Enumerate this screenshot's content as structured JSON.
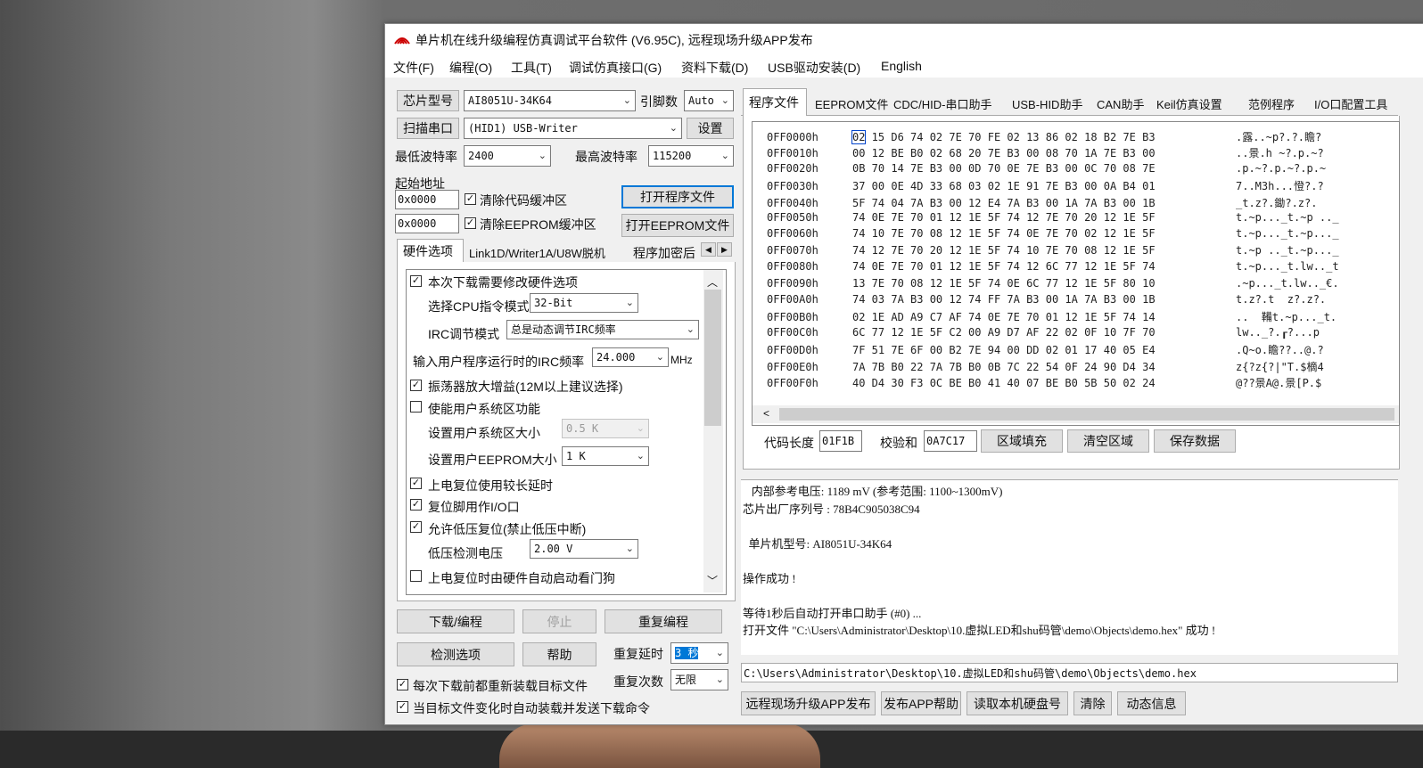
{
  "window": {
    "title": "单片机在线升级编程仿真调试平台软件 (V6.95C), 远程现场升级APP发布"
  },
  "menu": [
    "文件(F)",
    "编程(O)",
    "工具(T)",
    "调试仿真接口(G)",
    "资料下载(D)",
    "USB驱动安装(D)",
    "English"
  ],
  "left": {
    "chip_label": "芯片型号",
    "chip_value": "AI8051U-34K64",
    "pins_label": "引脚数",
    "pins_value": "Auto",
    "scan_button": "扫描串口",
    "port_value": "(HID1) USB-Writer",
    "settings_button": "设置",
    "min_baud_label": "最低波特率",
    "min_baud_value": "2400",
    "max_baud_label": "最高波特率",
    "max_baud_value": "115200",
    "start_addr_label": "起始地址",
    "addr1": "0x0000",
    "clear_code_label": "清除代码缓冲区",
    "open_program_button": "打开程序文件",
    "addr2": "0x0000",
    "clear_eeprom_label": "清除EEPROM缓冲区",
    "open_eeprom_button": "打开EEPROM文件",
    "tabs": [
      "硬件选项",
      "Link1D/Writer1A/U8W脱机",
      "程序加密后"
    ],
    "hw": {
      "modify_hw": "本次下载需要修改硬件选项",
      "cpu_mode_label": "选择CPU指令模式",
      "cpu_mode_value": "32-Bit",
      "irc_mode_label": "IRC调节模式",
      "irc_mode_value": "总是动态调节IRC频率",
      "irc_freq_label": "输入用户程序运行时的IRC频率",
      "irc_freq_value": "24.000",
      "irc_freq_unit": "MHz",
      "osc_gain": "振荡器放大增益(12M以上建议选择)",
      "user_sys": "使能用户系统区功能",
      "user_sys_size_label": "设置用户系统区大小",
      "user_sys_size_value": "0.5 K",
      "eeprom_size_label": "设置用户EEPROM大小",
      "eeprom_size_value": "1   K",
      "por_delay": "上电复位使用较长延时",
      "reset_io": "复位脚用作I/O口",
      "lvr": "允许低压复位(禁止低压中断)",
      "lvd_label": "低压检测电压",
      "lvd_value": "2.00 V",
      "wdt": "上电复位时由硬件自动启动看门狗"
    },
    "download_button": "下载/编程",
    "stop_button": "停止",
    "repeat_button": "重复编程",
    "check_button": "检测选项",
    "help_button": "帮助",
    "repeat_delay_label": "重复延时",
    "repeat_delay_value": "3 秒",
    "repeat_count_label": "重复次数",
    "repeat_count_value": "无限",
    "reload_label": "每次下载前都重新装载目标文件",
    "auto_load_label": "当目标文件变化时自动装载并发送下载命令"
  },
  "right": {
    "tabs": [
      "程序文件",
      "EEPROM文件",
      "CDC/HID-串口助手",
      "USB-HID助手",
      "CAN助手",
      "Keil仿真设置",
      "范例程序",
      "I/O口配置工具"
    ],
    "hex_rows": [
      {
        "addr": "0FF0000h",
        "bytes": "02 15 D6 74 02 7E 70 FE 02 13 86 02 18 B2 7E B3",
        "ascii": ".露..~p?.?.瞻?"
      },
      {
        "addr": "0FF0010h",
        "bytes": "00 12 BE B0 02 68 20 7E B3 00 08 70 1A 7E B3 00",
        "ascii": "..景.h ~?.p.~?"
      },
      {
        "addr": "0FF0020h",
        "bytes": "0B 70 14 7E B3 00 0D 70 0E 7E B3 00 0C 70 08 7E",
        "ascii": ".p.~?.p.~?.p.~"
      },
      {
        "addr": "0FF0030h",
        "bytes": "37 00 0E 4D 33 68 03 02 1E 91 7E B3 00 0A B4 01",
        "ascii": "7..M3h...憕?.?"
      },
      {
        "addr": "0FF0040h",
        "bytes": "5F 74 04 7A B3 00 12 E4 7A B3 00 1A 7A B3 00 1B",
        "ascii": "_t.z?.鋤?.z?."
      },
      {
        "addr": "0FF0050h",
        "bytes": "74 0E 7E 70 01 12 1E 5F 74 12 7E 70 20 12 1E 5F",
        "ascii": "t.~p..._t.~p .._"
      },
      {
        "addr": "0FF0060h",
        "bytes": "74 10 7E 70 08 12 1E 5F 74 0E 7E 70 02 12 1E 5F",
        "ascii": "t.~p..._t.~p..._"
      },
      {
        "addr": "0FF0070h",
        "bytes": "74 12 7E 70 20 12 1E 5F 74 10 7E 70 08 12 1E 5F",
        "ascii": "t.~p .._t.~p..._"
      },
      {
        "addr": "0FF0080h",
        "bytes": "74 0E 7E 70 01 12 1E 5F 74 12 6C 77 12 1E 5F 74",
        "ascii": "t.~p..._t.lw.._t"
      },
      {
        "addr": "0FF0090h",
        "bytes": "13 7E 70 08 12 1E 5F 74 0E 6C 77 12 1E 5F 80 10",
        "ascii": ".~p..._t.lw.._€."
      },
      {
        "addr": "0FF00A0h",
        "bytes": "74 03 7A B3 00 12 74 FF 7A B3 00 1A 7A B3 00 1B",
        "ascii": "t.z?.t  z?.z?."
      },
      {
        "addr": "0FF00B0h",
        "bytes": "02 1E AD A9 C7 AF 74 0E 7E 70 01 12 1E 5F 74 14",
        "ascii": "..  鞴t.~p..._t."
      },
      {
        "addr": "0FF00C0h",
        "bytes": "6C 77 12 1E 5F C2 00 A9 D7 AF 22 02 0F 10 7F 70",
        "ascii": "lw.._?.┎?...p"
      },
      {
        "addr": "0FF00D0h",
        "bytes": "7F 51 7E 6F 00 B2 7E 94 00 DD 02 01 17 40 05 E4",
        "ascii": ".Q~o.瞻??..@.?"
      },
      {
        "addr": "0FF00E0h",
        "bytes": "7A 7B B0 22 7A 7B B0 0B 7C 22 54 0F 24 90 D4 34",
        "ascii": "z{?z{?|\"T.$樀4"
      },
      {
        "addr": "0FF00F0h",
        "bytes": "40 D4 30 F3 0C BE B0 41 40 07 BE B0 5B 50 02 24",
        "ascii": "@??景A@.景[P.$"
      }
    ],
    "code_len_label": "代码长度",
    "code_len_value": "01F1B",
    "checksum_label": "校验和",
    "checksum_value": "0A7C17",
    "fill_button": "区域填充",
    "clear_button": "清空区域",
    "save_button": "保存数据",
    "log": [
      "   内部参考电压: 1189 mV (参考范围: 1100~1300mV)",
      "芯片出厂序列号 : 78B4C905038C94",
      "",
      "  单片机型号: AI8051U-34K64",
      "",
      "操作成功 !",
      "",
      "等待1秒后自动打开串口助手 (#0) ...",
      "打开文件 \"C:\\Users\\Administrator\\Desktop\\10.虚拟LED和shu码管\\demo\\Objects\\demo.hex\" 成功 !"
    ],
    "path": "C:\\Users\\Administrator\\Desktop\\10.虚拟LED和shu码管\\demo\\Objects\\demo.hex",
    "bottom_buttons": [
      "远程现场升级APP发布",
      "发布APP帮助",
      "读取本机硬盘号",
      "清除",
      "动态信息"
    ]
  }
}
